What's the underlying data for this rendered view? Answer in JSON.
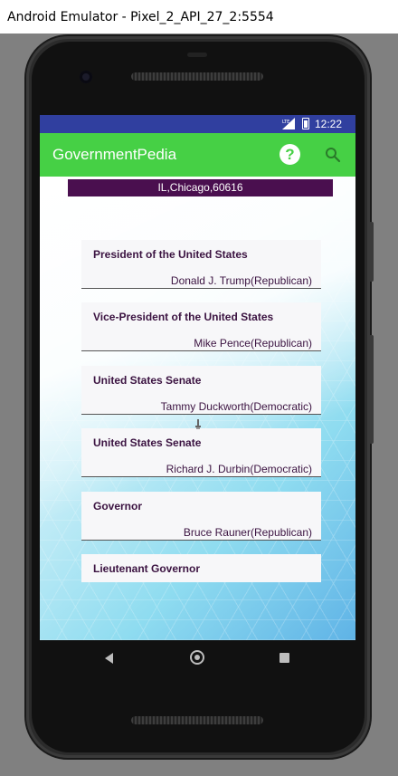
{
  "window": {
    "title": "Android Emulator - Pixel_2_API_27_2:5554"
  },
  "status_bar": {
    "time": "12:22",
    "network": "LTE"
  },
  "app_bar": {
    "title": "GovernmentPedia",
    "help_icon": "help-icon",
    "search_icon": "search-icon"
  },
  "location": "IL,Chicago,60616",
  "cards": [
    {
      "title": "President of the United States",
      "name": "Donald J. Trump(Republican)"
    },
    {
      "title": "Vice-President of the United States",
      "name": "Mike Pence(Republican)"
    },
    {
      "title": "United States Senate",
      "name": "Tammy Duckworth(Democratic)"
    },
    {
      "title": "United States Senate",
      "name": "Richard J. Durbin(Democratic)"
    },
    {
      "title": "Governor",
      "name": "Bruce Rauner(Republican)"
    },
    {
      "title": "Lieutenant Governor",
      "name": ""
    }
  ],
  "colors": {
    "app_bar": "#46d045",
    "status_bar": "#303f9f",
    "location_bar": "#4a0f4f",
    "card_text": "#3b1341"
  }
}
